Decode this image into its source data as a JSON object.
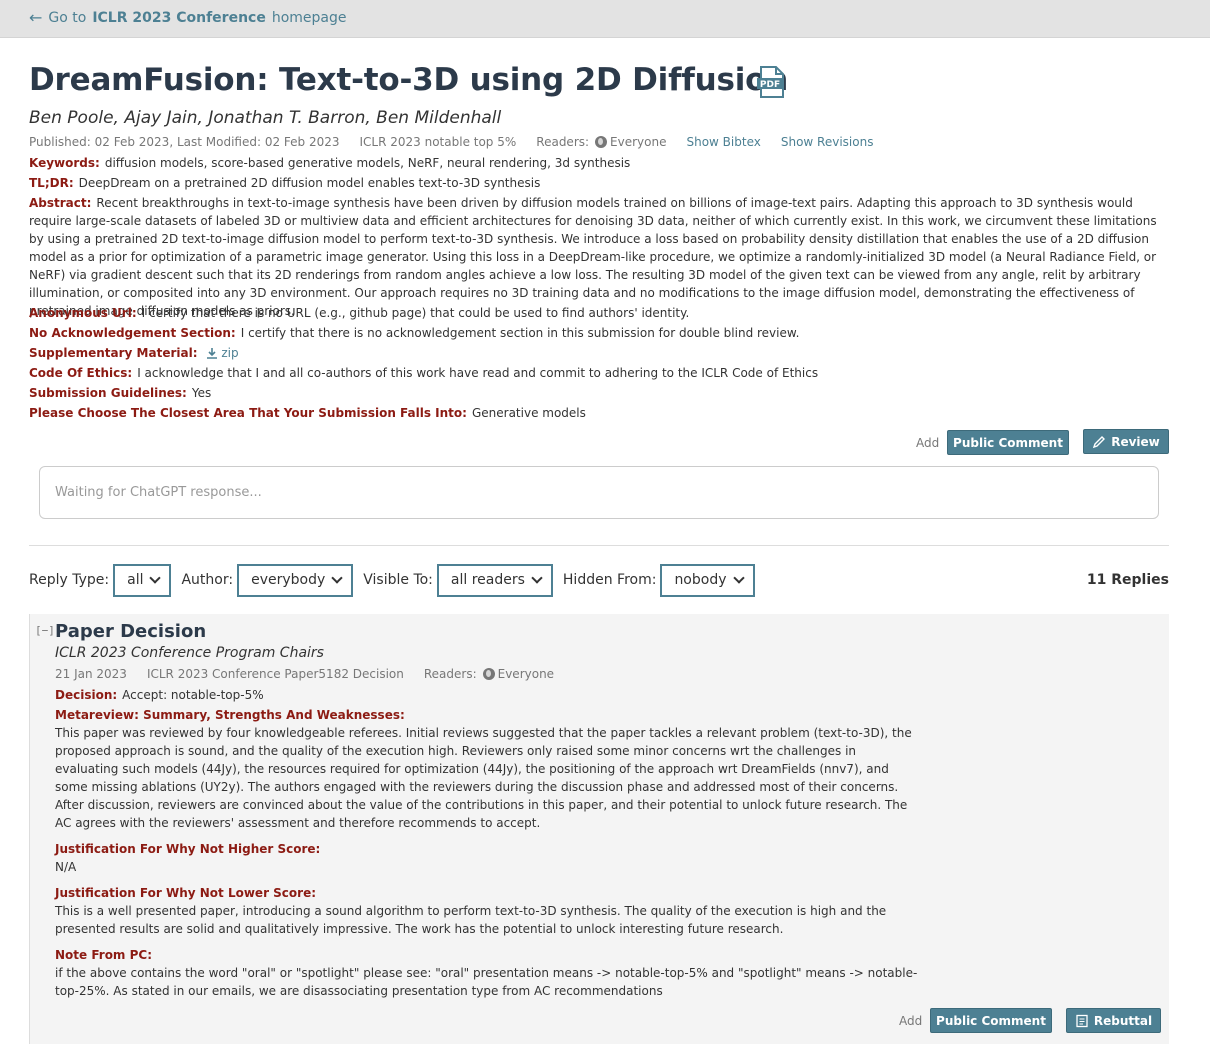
{
  "nav": {
    "back_prefix": "Go to",
    "back_venue": "ICLR 2023 Conference",
    "back_suffix": "homepage"
  },
  "paper": {
    "title": "DreamFusion: Text-to-3D using 2D Diffusion",
    "pdf_label": "PDF",
    "authors": "Ben Poole, Ajay Jain, Jonathan T. Barron, Ben Mildenhall",
    "published": "Published: 02 Feb 2023, Last Modified: 02 Feb 2023",
    "venue": "ICLR 2023 notable top 5%",
    "readers_label": "Readers:",
    "readers_value": "Everyone",
    "show_bibtex": "Show Bibtex",
    "show_revisions": "Show Revisions",
    "fields": {
      "keywords_label": "Keywords:",
      "keywords": "diffusion models, score-based generative models, NeRF, neural rendering, 3d synthesis",
      "tldr_label": "TL;DR:",
      "tldr": "DeepDream on a pretrained 2D diffusion model enables text-to-3D synthesis",
      "abstract_label": "Abstract:",
      "abstract": "Recent breakthroughs in text-to-image synthesis have been driven by diffusion models trained on billions of image-text pairs. Adapting this approach to 3D synthesis would require large-scale datasets of labeled 3D or multiview data and efficient architectures for denoising 3D data, neither of which currently exist. In this work, we circumvent these limitations by using a pretrained 2D text-to-image diffusion model to perform text-to-3D synthesis. We introduce a loss based on probability density distillation that enables the use of a 2D diffusion model as a prior for optimization of a parametric image generator. Using this loss in a DeepDream-like procedure, we optimize a randomly-initialized 3D model (a Neural Radiance Field, or NeRF) via gradient descent such that its 2D renderings from random angles achieve a low loss. The resulting 3D model of the given text can be viewed from any angle, relit by arbitrary illumination, or composited into any 3D environment. Our approach requires no 3D training data and no modifications to the image diffusion model, demonstrating the effectiveness of pretrained image diffusion models as priors.",
      "anon_url_label": "Anonymous Url:",
      "anon_url": "I certify that there is no URL (e.g., github page) that could be used to find authors' identity.",
      "no_ack_label": "No Acknowledgement Section:",
      "no_ack": "I certify that there is no acknowledgement section in this submission for double blind review.",
      "supp_label": "Supplementary Material:",
      "supp": "zip",
      "ethics_label": "Code Of Ethics:",
      "ethics": "I acknowledge that I and all co-authors of this work have read and commit to adhering to the ICLR Code of Ethics",
      "guidelines_label": "Submission Guidelines:",
      "guidelines": "Yes",
      "area_label": "Please Choose The Closest Area That Your Submission Falls Into:",
      "area": "Generative models"
    },
    "actions": {
      "add": "Add",
      "public_comment": "Public Comment",
      "review": "Review"
    }
  },
  "chat": {
    "placeholder": "Waiting for ChatGPT response..."
  },
  "filters": {
    "reply_type_label": "Reply Type:",
    "reply_type": "all",
    "author_label": "Author:",
    "author": "everybody",
    "visible_label": "Visible To:",
    "visible": "all readers",
    "hidden_label": "Hidden From:",
    "hidden": "nobody",
    "replies_count": "11 Replies"
  },
  "decision": {
    "collapse": "[−]",
    "title": "Paper Decision",
    "signature": "ICLR 2023 Conference Program Chairs",
    "date": "21 Jan 2023",
    "invitation": "ICLR 2023 Conference Paper5182 Decision",
    "readers_label": "Readers:",
    "readers_value": "Everyone",
    "decision_label": "Decision:",
    "decision": "Accept: notable-top-5%",
    "metareview_label": "Metareview: Summary, Strengths And Weaknesses:",
    "metareview": "This paper was reviewed by four knowledgeable referees. Initial reviews suggested that the paper tackles a relevant problem (text-to-3D), the proposed approach is sound, and the quality of the execution high. Reviewers only raised some minor concerns wrt the challenges in evaluating such models (44Jy), the resources required for optimization (44Jy), the positioning of the approach wrt DreamFields (nnv7), and some missing ablations (UY2y). The authors engaged with the reviewers during the discussion phase and addressed most of their concerns. After discussion, reviewers are convinced about the value of the contributions in this paper, and their potential to unlock future research. The AC agrees with the reviewers' assessment and therefore recommends to accept.",
    "higher_label": "Justification For Why Not Higher Score:",
    "higher": "N/A",
    "lower_label": "Justification For Why Not Lower Score:",
    "lower": "This is a well presented paper, introducing a sound algorithm to perform text-to-3D synthesis. The quality of the execution is high and the presented results are solid and qualitatively impressive. The work has the potential to unlock interesting future research.",
    "pc_label": "Note From PC:",
    "pc": "if the above contains the word \"oral\" or \"spotlight\" please see: \"oral\" presentation means -> notable-top-5% and \"spotlight\" means -> notable-top-25%. As stated in our emails, we are disassociating presentation type from AC recommendations",
    "actions": {
      "add": "Add",
      "public_comment": "Public Comment",
      "rebuttal": "Rebuttal"
    }
  },
  "colors": {
    "accent": "#4d8093",
    "field_label": "#8c1b13",
    "title": "#2c3a4a"
  }
}
